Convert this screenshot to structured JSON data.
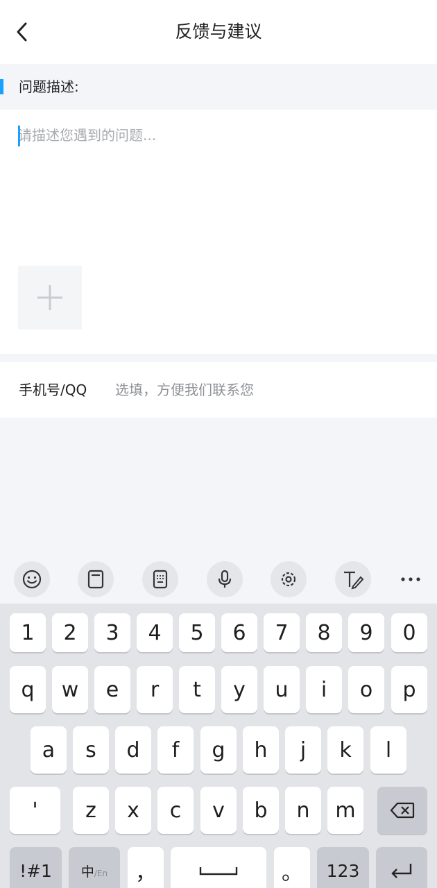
{
  "header": {
    "title": "反馈与建议",
    "back_icon": "chevron-left-icon"
  },
  "section": {
    "label": "问题描述:"
  },
  "description": {
    "placeholder": "请描述您遇到的问题...",
    "add_icon": "plus-icon"
  },
  "contact": {
    "label": "手机号/QQ",
    "placeholder": "选填，方便我们联系您"
  },
  "toolbar": {
    "icons": [
      "emoji-icon",
      "clipboard-icon",
      "keypad-icon",
      "microphone-icon",
      "gear-icon",
      "handwriting-icon",
      "more-icon"
    ]
  },
  "keyboard": {
    "row1": [
      "1",
      "2",
      "3",
      "4",
      "5",
      "6",
      "7",
      "8",
      "9",
      "0"
    ],
    "row2": [
      "q",
      "w",
      "e",
      "r",
      "t",
      "y",
      "u",
      "i",
      "o",
      "p"
    ],
    "row3": [
      "a",
      "s",
      "d",
      "f",
      "g",
      "h",
      "j",
      "k",
      "l"
    ],
    "row4": [
      "'",
      "z",
      "x",
      "c",
      "v",
      "b",
      "n",
      "m"
    ],
    "row5": {
      "symbols": "!#1",
      "lang_main": "中",
      "lang_sub": "/En",
      "comma": "，",
      "period": "。",
      "numbers": "123"
    }
  },
  "colors": {
    "accent": "#1aa1ff",
    "background": "#f3f5f8",
    "keyboard_bg": "#e3e4e8",
    "function_key": "#c7cad0"
  }
}
